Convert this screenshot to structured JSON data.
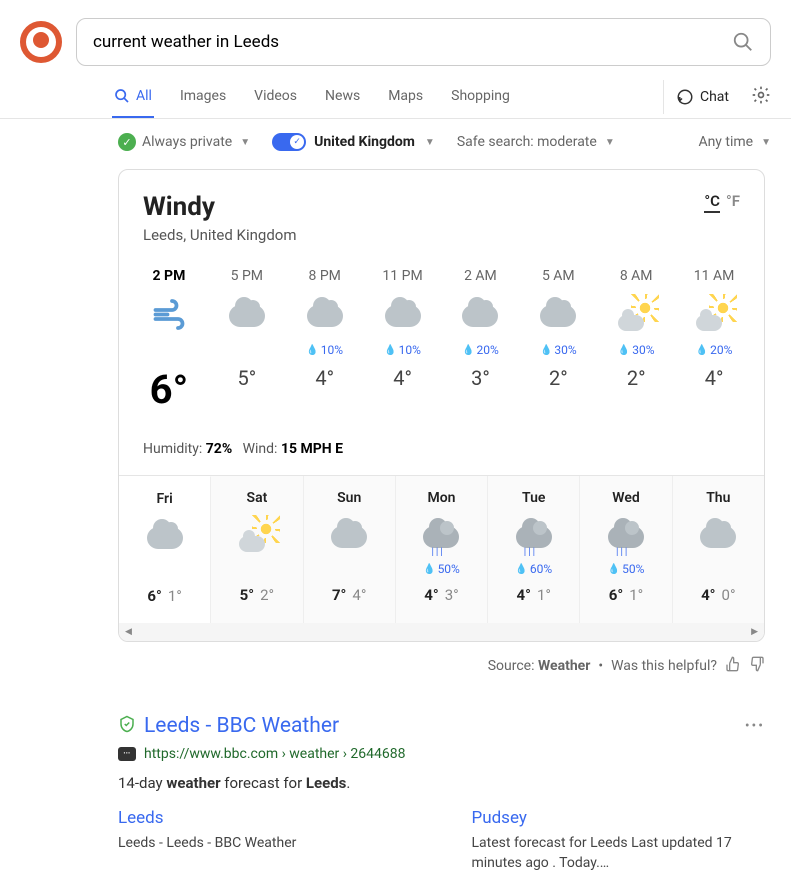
{
  "search": {
    "query": "current weather in Leeds"
  },
  "tabs": [
    {
      "label": "All",
      "active": true
    },
    {
      "label": "Images"
    },
    {
      "label": "Videos"
    },
    {
      "label": "News"
    },
    {
      "label": "Maps"
    },
    {
      "label": "Shopping"
    }
  ],
  "chat_label": "Chat",
  "filters": {
    "privacy": "Always private",
    "region": "United Kingdom",
    "safe": "Safe search: moderate",
    "time": "Any time"
  },
  "weather": {
    "condition": "Windy",
    "location": "Leeds, United Kingdom",
    "unit_c": "°C",
    "unit_f": "°F",
    "hourly": [
      {
        "time": "2 PM",
        "icon": "wind",
        "precip": "",
        "temp": "6°",
        "now": true
      },
      {
        "time": "5 PM",
        "icon": "cloud",
        "precip": "",
        "temp": "5°"
      },
      {
        "time": "8 PM",
        "icon": "cloud",
        "precip": "10%",
        "temp": "4°"
      },
      {
        "time": "11 PM",
        "icon": "cloud",
        "precip": "10%",
        "temp": "4°"
      },
      {
        "time": "2 AM",
        "icon": "cloud",
        "precip": "20%",
        "temp": "3°"
      },
      {
        "time": "5 AM",
        "icon": "cloud",
        "precip": "30%",
        "temp": "2°"
      },
      {
        "time": "8 AM",
        "icon": "sun",
        "precip": "30%",
        "temp": "2°"
      },
      {
        "time": "11 AM",
        "icon": "sun",
        "precip": "20%",
        "temp": "4°"
      }
    ],
    "humidity_label": "Humidity:",
    "humidity": "72%",
    "wind_label": "Wind:",
    "wind": "15 MPH E",
    "daily": [
      {
        "day": "Fri",
        "icon": "cloud",
        "precip": "",
        "hi": "6°",
        "lo": "1°",
        "active": true
      },
      {
        "day": "Sat",
        "icon": "partly",
        "precip": "",
        "hi": "5°",
        "lo": "2°"
      },
      {
        "day": "Sun",
        "icon": "cloud",
        "precip": "",
        "hi": "7°",
        "lo": "4°"
      },
      {
        "day": "Mon",
        "icon": "rain",
        "precip": "50%",
        "hi": "4°",
        "lo": "3°"
      },
      {
        "day": "Tue",
        "icon": "rain",
        "precip": "60%",
        "hi": "4°",
        "lo": "1°"
      },
      {
        "day": "Wed",
        "icon": "rain",
        "precip": "50%",
        "hi": "6°",
        "lo": "1°"
      },
      {
        "day": "Thu",
        "icon": "cloud",
        "precip": "",
        "hi": "4°",
        "lo": "0°"
      }
    ]
  },
  "source": {
    "prefix": "Source:",
    "brand": "Weather",
    "helpful": "Was this helpful?"
  },
  "result": {
    "title": "Leeds - BBC Weather",
    "url": "https://www.bbc.com › weather › 2644688",
    "snippet_pre": "14-day ",
    "snippet_b1": "weather",
    "snippet_mid": " forecast for ",
    "snippet_b2": "Leeds",
    "snippet_post": ".",
    "sitelinks": [
      {
        "title": "Leeds",
        "desc": "Leeds - Leeds - BBC Weather"
      },
      {
        "title": "Pudsey",
        "desc": "Latest forecast for Leeds Last updated 17 minutes ago . Today.…"
      }
    ]
  }
}
